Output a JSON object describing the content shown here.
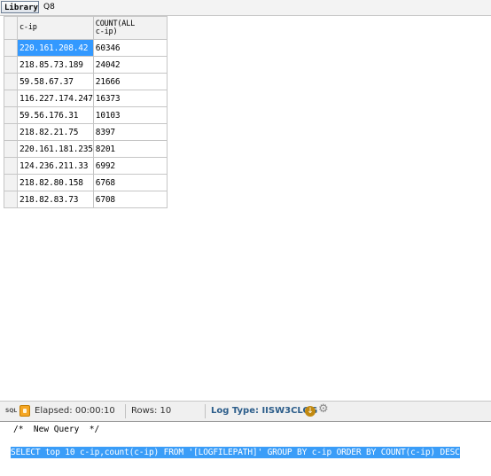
{
  "tabs": [
    {
      "label": "Library"
    },
    {
      "label": "Q8"
    }
  ],
  "grid": {
    "headers": [
      "c-ip",
      "COUNT(ALL\nc-ip)"
    ],
    "rows": [
      [
        "220.161.208.42",
        "60346"
      ],
      [
        "218.85.73.189",
        "24042"
      ],
      [
        "59.58.67.37",
        "21666"
      ],
      [
        "116.227.174.247",
        "16373"
      ],
      [
        "59.56.176.31",
        "10103"
      ],
      [
        "218.82.21.75",
        "8397"
      ],
      [
        "220.161.181.235",
        "8201"
      ],
      [
        "124.236.211.33",
        "6992"
      ],
      [
        "218.82.80.158",
        "6768"
      ],
      [
        "218.82.83.73",
        "6708"
      ]
    ]
  },
  "status": {
    "sql_label": "SQL",
    "elapsed": "Elapsed: 00:00:10",
    "rows": "Rows: 10",
    "log_type": "Log Type: IISW3CLOG"
  },
  "editor": {
    "comment": "/*  New Query  */",
    "query": "SELECT top 10 c-ip,count(c-ip) FROM '[LOGFILEPATH]' GROUP BY c-ip ORDER BY COUNT(c-ip) DESC"
  },
  "colors": {
    "selection": "#3399ff",
    "log_type": "#2c5d8a",
    "lock_icon": "#f5a623"
  }
}
